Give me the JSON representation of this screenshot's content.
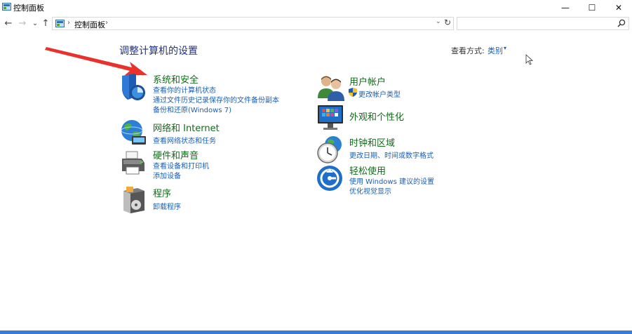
{
  "window": {
    "title": "控制面板",
    "minimize_label": "—",
    "maximize_label": "☐",
    "close_label": "✕"
  },
  "nav": {
    "back": "←",
    "forward": "→",
    "recent": "⌄",
    "up": "↑",
    "breadcrumb_sep": "›",
    "breadcrumb": "控制面板",
    "breadcrumb_trail_sep": "›",
    "dropdown": "⌄",
    "refresh": "↻",
    "search_placeholder": ""
  },
  "header": {
    "title": "调整计算机的设置",
    "view_by_label": "查看方式:",
    "view_by_value": "类别",
    "view_by_dropdown": "▾"
  },
  "categories_left": [
    {
      "title": "系统和安全",
      "links": [
        "查看你的计算机状态",
        "通过文件历史记录保存你的文件备份副本",
        "备份和还原(Windows 7)"
      ]
    },
    {
      "title": "网络和 Internet",
      "links": [
        "查看网络状态和任务"
      ]
    },
    {
      "title": "硬件和声音",
      "links": [
        "查看设备和打印机",
        "添加设备"
      ]
    },
    {
      "title": "程序",
      "links": [
        "卸载程序"
      ]
    }
  ],
  "categories_right": [
    {
      "title": "用户帐户",
      "links": [
        "更改帐户类型"
      ]
    },
    {
      "title": "外观和个性化",
      "links": []
    },
    {
      "title": "时钟和区域",
      "links": [
        "更改日期、时间或数字格式"
      ]
    },
    {
      "title": "轻松使用",
      "links": [
        "使用 Windows 建议的设置",
        "优化视觉显示"
      ]
    }
  ],
  "colors": {
    "category_title": "#106c19",
    "link": "#1a5fb4",
    "page_title": "#1e3287",
    "annotation_arrow": "#e8322b"
  }
}
